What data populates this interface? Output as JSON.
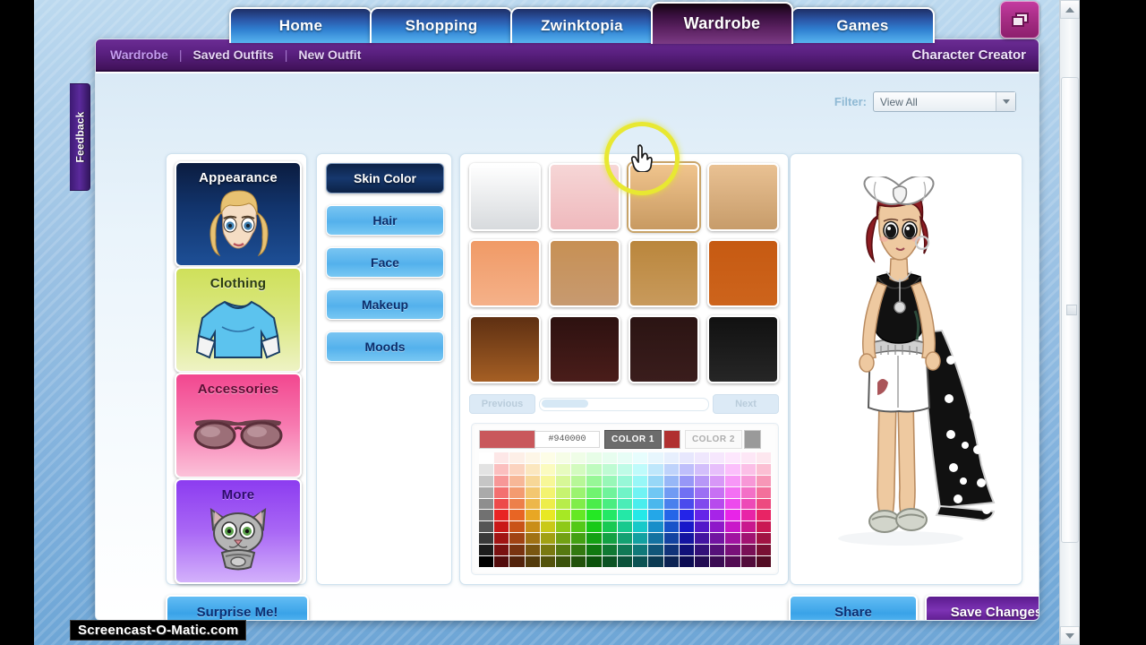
{
  "nav": {
    "tabs": [
      {
        "label": "Home",
        "active": false
      },
      {
        "label": "Shopping",
        "active": false
      },
      {
        "label": "Zwinktopia",
        "active": false
      },
      {
        "label": "Wardrobe",
        "active": true
      },
      {
        "label": "Games",
        "active": false
      }
    ],
    "window_button_icon": "restore-window-icon"
  },
  "subnav": {
    "links": [
      "Wardrobe",
      "Saved Outfits",
      "New Outfit"
    ],
    "separator": "|",
    "right_title": "Character Creator"
  },
  "feedback_tab": {
    "label": "Feedback"
  },
  "filter": {
    "label": "Filter:",
    "value": "View All",
    "arrow_icon": "chevron-down-icon"
  },
  "categories": [
    {
      "label": "Appearance",
      "art": "female-face-icon",
      "active": true
    },
    {
      "label": "Clothing",
      "art": "tshirt-icon",
      "active": false
    },
    {
      "label": "Accessories",
      "art": "sunglasses-icon",
      "active": false
    },
    {
      "label": "More",
      "art": "cat-pet-icon",
      "active": false
    }
  ],
  "subcategories": [
    {
      "label": "Skin Color",
      "active": true
    },
    {
      "label": "Hair",
      "active": false
    },
    {
      "label": "Face",
      "active": false
    },
    {
      "label": "Makeup",
      "active": false
    },
    {
      "label": "Moods",
      "active": false
    }
  ],
  "swatches": [
    {
      "name": "swatch-white",
      "top": "#ffffff",
      "bottom": "#d7dadd",
      "selected": false
    },
    {
      "name": "swatch-pink",
      "top": "#f6d6d6",
      "bottom": "#efb9bd",
      "selected": false
    },
    {
      "name": "swatch-light-tan",
      "top": "#f0c48d",
      "bottom": "#c89a62",
      "selected": true
    },
    {
      "name": "swatch-tan",
      "top": "#e9c193",
      "bottom": "#c79c6a",
      "selected": false
    },
    {
      "name": "swatch-peach",
      "top": "#f09a66",
      "bottom": "#f5b189",
      "selected": false
    },
    {
      "name": "swatch-medium-tan",
      "top": "#c79054",
      "bottom": "#c79a70",
      "selected": false
    },
    {
      "name": "swatch-golden-brown",
      "top": "#ba863c",
      "bottom": "#c89a5c",
      "selected": false
    },
    {
      "name": "swatch-burnt-orange",
      "top": "#c65a12",
      "bottom": "#cd641c",
      "selected": false
    },
    {
      "name": "swatch-brown",
      "top": "#5e2f12",
      "bottom": "#a55f24",
      "selected": false
    },
    {
      "name": "swatch-dark-maroon",
      "top": "#2d1110",
      "bottom": "#4a1d1a",
      "selected": false
    },
    {
      "name": "swatch-darkest-brown",
      "top": "#2b1413",
      "bottom": "#3a1d1c",
      "selected": false
    },
    {
      "name": "swatch-black",
      "top": "#111111",
      "bottom": "#262626",
      "selected": false
    }
  ],
  "pager": {
    "previous": "Previous",
    "next": "Next"
  },
  "color_picker": {
    "current_color": "#c9585c",
    "hex_value": "#940000",
    "color1_label": "COLOR 1",
    "color1_chip": "#b03030",
    "color1_active": true,
    "color2_label": "COLOR 2",
    "color2_chip": "#9a9a9a",
    "color2_active": false
  },
  "avatar": {
    "name": "character-avatar",
    "hair_color": "#8d1c22",
    "bow_color": "#ffffff",
    "top_color": "#111111",
    "shorts_color": "#ffffff",
    "skin_color": "#eec9a0",
    "cape_color": "#111111"
  },
  "buttons": {
    "surprise": "Surprise Me!",
    "share": "Share",
    "save": "Save Changes"
  },
  "watermark": {
    "text": "Screencast-O-Matic.com"
  },
  "cursor": {
    "icon": "pointing-hand-cursor",
    "highlight": "#e8e832"
  }
}
